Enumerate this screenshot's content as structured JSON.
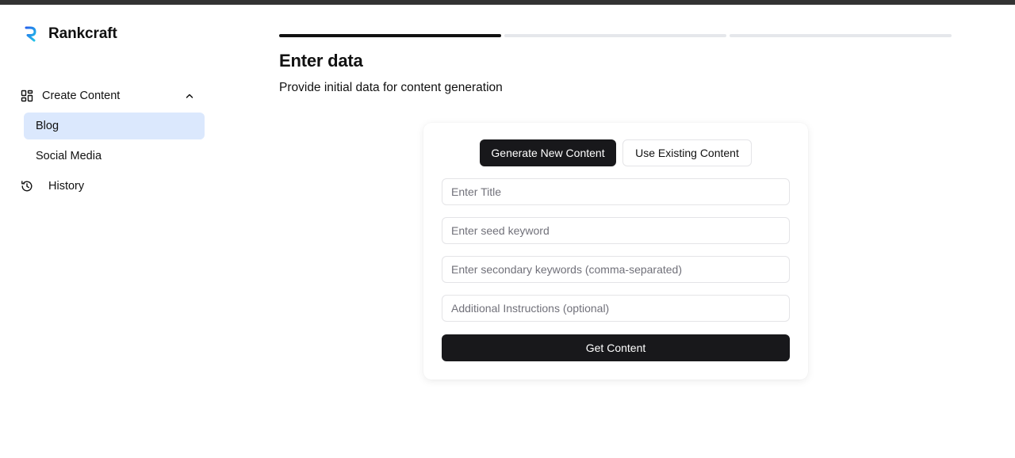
{
  "app": {
    "name": "Rankcraft",
    "logo_icon": "rankcraft-logo-icon",
    "accent_color": "#1d9bf0"
  },
  "sidebar": {
    "section": {
      "label": "Create Content",
      "icon": "grid-layout-icon",
      "expanded": true
    },
    "items": [
      {
        "label": "Blog",
        "active": true
      },
      {
        "label": "Social Media",
        "active": false
      }
    ],
    "history": {
      "label": "History",
      "icon": "history-icon"
    },
    "active_color": "#dbe8fd"
  },
  "progress": {
    "total_steps": 3,
    "current_step": 1
  },
  "header": {
    "title": "Enter data",
    "subtitle": "Provide initial data for content generation"
  },
  "form": {
    "mode_buttons": [
      {
        "label": "Generate New Content",
        "selected": true
      },
      {
        "label": "Use Existing Content",
        "selected": false
      }
    ],
    "fields": [
      {
        "placeholder": "Enter Title",
        "value": ""
      },
      {
        "placeholder": "Enter seed keyword",
        "value": ""
      },
      {
        "placeholder": "Enter secondary keywords (comma-separated)",
        "value": ""
      },
      {
        "placeholder": "Additional Instructions (optional)",
        "value": ""
      }
    ],
    "submit_label": "Get Content",
    "button_color": "#18181b"
  }
}
